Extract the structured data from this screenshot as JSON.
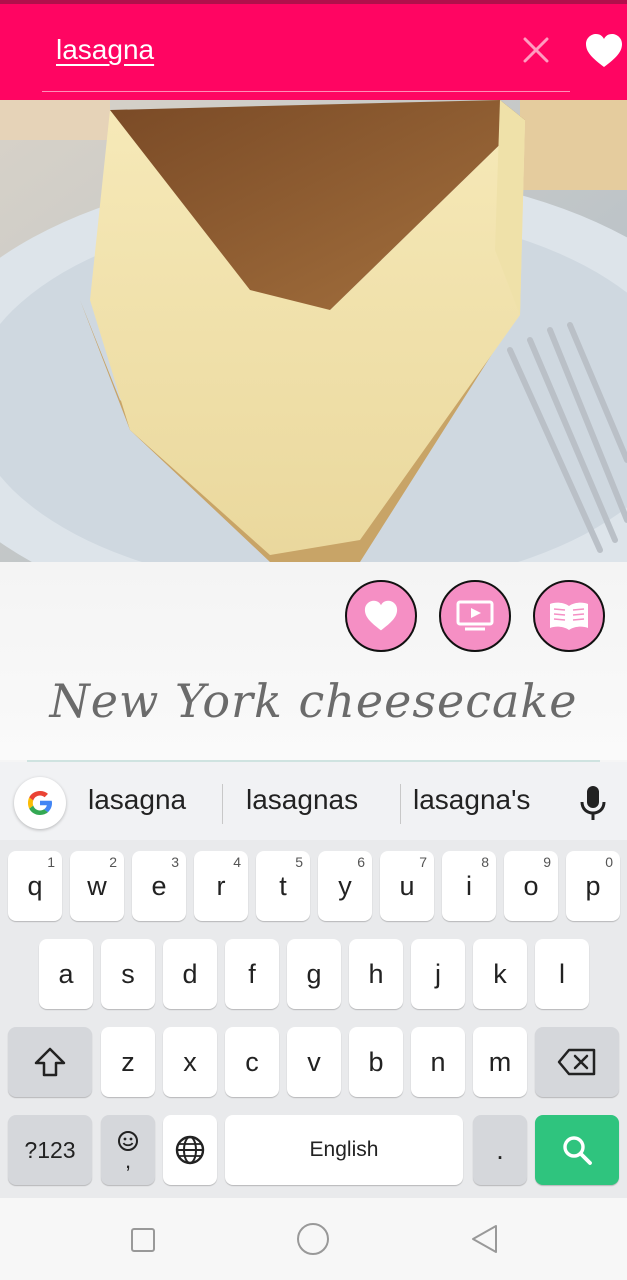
{
  "search": {
    "query": "lasagna"
  },
  "recipe": {
    "title": "New York cheesecake"
  },
  "keyboard": {
    "suggestions": [
      "lasagna",
      "lasagnas",
      "lasagna's"
    ],
    "row1": [
      {
        "key": "q",
        "hint": "1"
      },
      {
        "key": "w",
        "hint": "2"
      },
      {
        "key": "e",
        "hint": "3"
      },
      {
        "key": "r",
        "hint": "4"
      },
      {
        "key": "t",
        "hint": "5"
      },
      {
        "key": "y",
        "hint": "6"
      },
      {
        "key": "u",
        "hint": "7"
      },
      {
        "key": "i",
        "hint": "8"
      },
      {
        "key": "o",
        "hint": "9"
      },
      {
        "key": "p",
        "hint": "0"
      }
    ],
    "row2": [
      "a",
      "s",
      "d",
      "f",
      "g",
      "h",
      "j",
      "k",
      "l"
    ],
    "row3": [
      "z",
      "x",
      "c",
      "v",
      "b",
      "n",
      "m"
    ],
    "symbols_label": "?123",
    "emoji_comma": ",",
    "space_label": "English",
    "period_label": "."
  },
  "colors": {
    "header": "#ff0562",
    "accent_pink": "#f58fc4",
    "search_key": "#2fc47e"
  },
  "icons": [
    "close-icon",
    "heart-icon",
    "video-icon",
    "book-icon",
    "google-icon",
    "mic-icon",
    "shift-icon",
    "backspace-icon",
    "emoji-icon",
    "globe-icon",
    "search-icon",
    "recents-icon",
    "home-icon",
    "back-icon"
  ]
}
